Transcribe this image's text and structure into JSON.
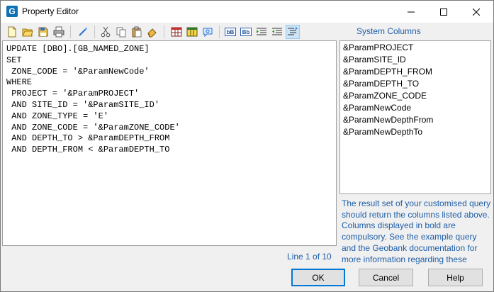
{
  "window": {
    "title": "Property Editor",
    "app_icon_letter": "G",
    "controls": [
      "minimize-icon",
      "maximize-icon",
      "close-icon"
    ]
  },
  "toolbar": {
    "buttons": [
      {
        "name": "new-icon"
      },
      {
        "name": "open-icon"
      },
      {
        "name": "save-icon"
      },
      {
        "name": "print-icon"
      },
      {
        "name": "wand-icon"
      },
      {
        "name": "cut-icon"
      },
      {
        "name": "copy-icon"
      },
      {
        "name": "paste-icon"
      },
      {
        "name": "eraser-icon"
      },
      {
        "name": "grid-icon"
      },
      {
        "name": "table-icon"
      },
      {
        "name": "find-icon"
      },
      {
        "name": "lowercase-b-icon",
        "label": "bB"
      },
      {
        "name": "uppercase-b-icon",
        "label": "Bb"
      },
      {
        "name": "indent-icon"
      },
      {
        "name": "outdent-icon"
      },
      {
        "name": "format-icon",
        "active": true
      }
    ]
  },
  "editor": {
    "lines": [
      "UPDATE [DBO].[GB_NAMED_ZONE]",
      "SET",
      " ZONE_CODE = '&ParamNewCode'",
      "WHERE",
      " PROJECT = '&ParamPROJECT'",
      " AND SITE_ID = '&ParamSITE_ID'",
      " AND ZONE_TYPE = 'E'",
      " AND ZONE_CODE = '&ParamZONE_CODE'",
      " AND DEPTH_TO > &ParamDEPTH_FROM",
      " AND DEPTH_FROM < &ParamDEPTH_TO"
    ]
  },
  "system_columns": {
    "title": "System Columns",
    "items": [
      "&ParamPROJECT",
      "&ParamSITE_ID",
      "&ParamDEPTH_FROM",
      "&ParamDEPTH_TO",
      "&ParamZONE_CODE",
      "&ParamNewCode",
      "&ParamNewDepthFrom",
      "&ParamNewDepthTo"
    ]
  },
  "info_text": "The result set of your customised query should return the columns listed above. Columns displayed in bold are compulsory. See the example query and the Geobank documentation for more information regarding these",
  "status": {
    "line": "Line 1 of 10"
  },
  "buttons": {
    "ok": "OK",
    "cancel": "Cancel",
    "help": "Help"
  },
  "colors": {
    "accent_text": "#1e5ea8",
    "app_icon": "#0e72b5",
    "default_button_border": "#0078d7"
  }
}
